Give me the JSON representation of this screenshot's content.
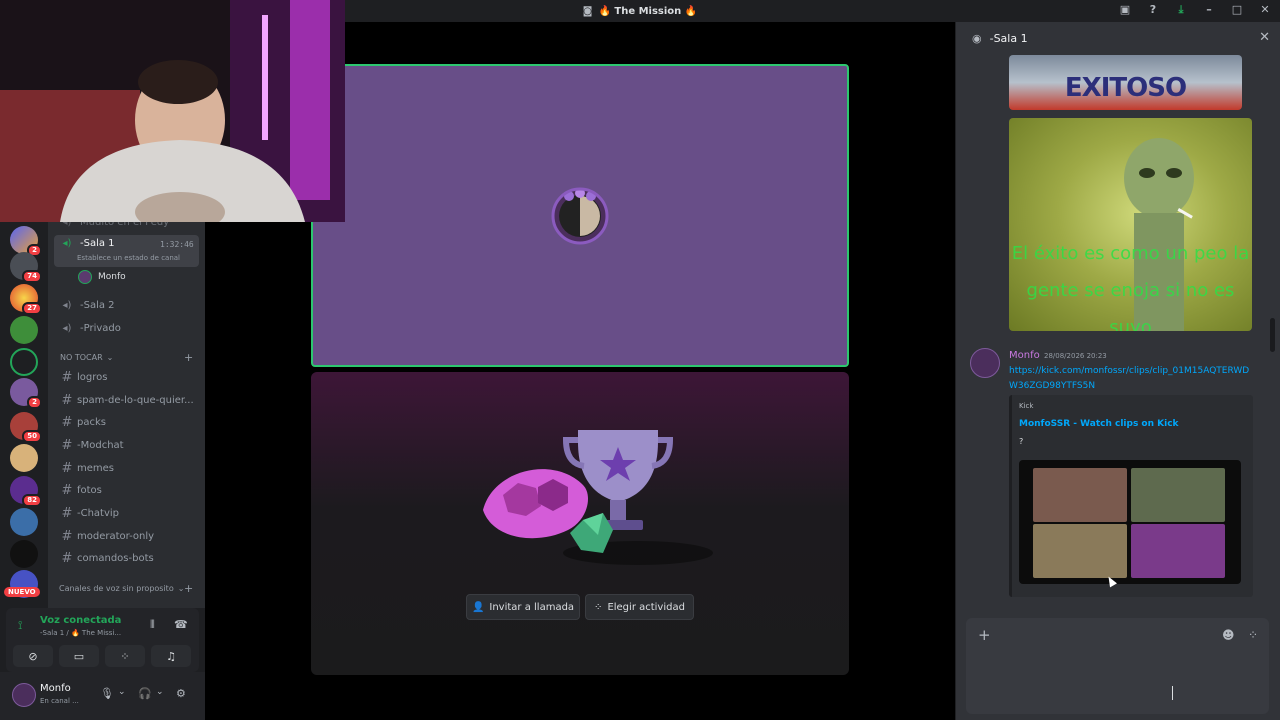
{
  "titlebar": {
    "title": "🔥 The Mission 🔥"
  },
  "sidebar": {
    "top_partial": "Mudito en el Pedy",
    "voice_channels": [
      {
        "label": "-Sala 1",
        "time": "1:32:46",
        "status": "Establece un estado de canal"
      },
      {
        "label": "-Sala 2"
      },
      {
        "label": "-Privado"
      }
    ],
    "member": "Monfo",
    "category": "NO TOCAR",
    "text_channels": [
      "logros",
      "spam-de-lo-que-quier...",
      "packs",
      "-Modchat",
      "memes",
      "fotos",
      "-Chatvip",
      "moderator-only",
      "comandos-bots"
    ],
    "voice_category": "Canales de voz sin proposito"
  },
  "servers": {
    "badges": [
      "2",
      "74",
      "27",
      "2",
      "50",
      "82"
    ],
    "new_label": "NUEVO"
  },
  "voice_panel": {
    "status": "Voz conectada",
    "subtitle": "-Sala 1 / 🔥 The Missi..."
  },
  "user_panel": {
    "name": "Monfo",
    "status": "En canal ..."
  },
  "stage": {
    "invite_label": "Invitar a llamada",
    "activity_label": "Elegir actividad"
  },
  "chat": {
    "channel_title": "-Sala 1",
    "image1_text": "EXITOSO",
    "image2_text": "El éxito es como un peo la gente se enoja si no es suyo",
    "author": "Monfo",
    "timestamp": "28/08/2026 20:23",
    "link": "https://kick.com/monfossr/clips/clip_01M15AQTERWDW36ZGD98YTFS5N",
    "embed": {
      "provider": "Kick",
      "title": "MonfoSSR - Watch clips on Kick",
      "description": "?"
    }
  },
  "colors": {
    "accent_green": "#23a559",
    "speaking_border": "#2dc770",
    "tile_purple": "#684e88",
    "link_blue": "#00a8fc",
    "author_purple": "#c879e0"
  }
}
